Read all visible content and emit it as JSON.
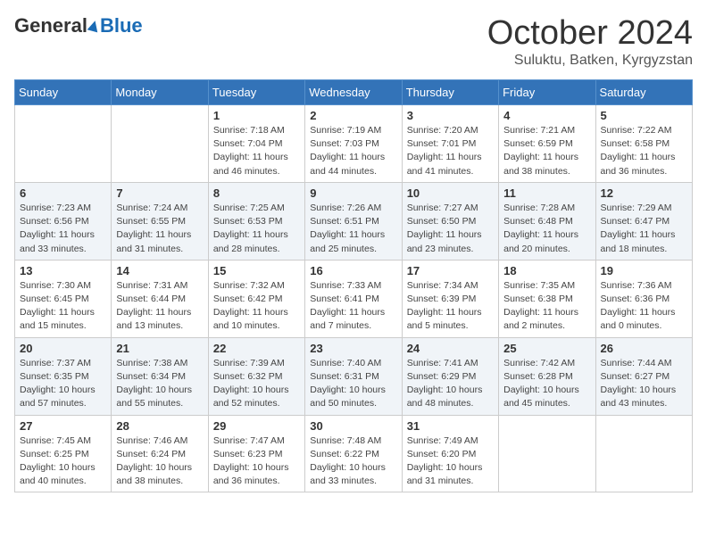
{
  "header": {
    "logo_general": "General",
    "logo_blue": "Blue",
    "month_title": "October 2024",
    "location": "Suluktu, Batken, Kyrgyzstan"
  },
  "days_of_week": [
    "Sunday",
    "Monday",
    "Tuesday",
    "Wednesday",
    "Thursday",
    "Friday",
    "Saturday"
  ],
  "weeks": [
    [
      {
        "day": "",
        "sunrise": "",
        "sunset": "",
        "daylight": ""
      },
      {
        "day": "",
        "sunrise": "",
        "sunset": "",
        "daylight": ""
      },
      {
        "day": "1",
        "sunrise": "Sunrise: 7:18 AM",
        "sunset": "Sunset: 7:04 PM",
        "daylight": "Daylight: 11 hours and 46 minutes."
      },
      {
        "day": "2",
        "sunrise": "Sunrise: 7:19 AM",
        "sunset": "Sunset: 7:03 PM",
        "daylight": "Daylight: 11 hours and 44 minutes."
      },
      {
        "day": "3",
        "sunrise": "Sunrise: 7:20 AM",
        "sunset": "Sunset: 7:01 PM",
        "daylight": "Daylight: 11 hours and 41 minutes."
      },
      {
        "day": "4",
        "sunrise": "Sunrise: 7:21 AM",
        "sunset": "Sunset: 6:59 PM",
        "daylight": "Daylight: 11 hours and 38 minutes."
      },
      {
        "day": "5",
        "sunrise": "Sunrise: 7:22 AM",
        "sunset": "Sunset: 6:58 PM",
        "daylight": "Daylight: 11 hours and 36 minutes."
      }
    ],
    [
      {
        "day": "6",
        "sunrise": "Sunrise: 7:23 AM",
        "sunset": "Sunset: 6:56 PM",
        "daylight": "Daylight: 11 hours and 33 minutes."
      },
      {
        "day": "7",
        "sunrise": "Sunrise: 7:24 AM",
        "sunset": "Sunset: 6:55 PM",
        "daylight": "Daylight: 11 hours and 31 minutes."
      },
      {
        "day": "8",
        "sunrise": "Sunrise: 7:25 AM",
        "sunset": "Sunset: 6:53 PM",
        "daylight": "Daylight: 11 hours and 28 minutes."
      },
      {
        "day": "9",
        "sunrise": "Sunrise: 7:26 AM",
        "sunset": "Sunset: 6:51 PM",
        "daylight": "Daylight: 11 hours and 25 minutes."
      },
      {
        "day": "10",
        "sunrise": "Sunrise: 7:27 AM",
        "sunset": "Sunset: 6:50 PM",
        "daylight": "Daylight: 11 hours and 23 minutes."
      },
      {
        "day": "11",
        "sunrise": "Sunrise: 7:28 AM",
        "sunset": "Sunset: 6:48 PM",
        "daylight": "Daylight: 11 hours and 20 minutes."
      },
      {
        "day": "12",
        "sunrise": "Sunrise: 7:29 AM",
        "sunset": "Sunset: 6:47 PM",
        "daylight": "Daylight: 11 hours and 18 minutes."
      }
    ],
    [
      {
        "day": "13",
        "sunrise": "Sunrise: 7:30 AM",
        "sunset": "Sunset: 6:45 PM",
        "daylight": "Daylight: 11 hours and 15 minutes."
      },
      {
        "day": "14",
        "sunrise": "Sunrise: 7:31 AM",
        "sunset": "Sunset: 6:44 PM",
        "daylight": "Daylight: 11 hours and 13 minutes."
      },
      {
        "day": "15",
        "sunrise": "Sunrise: 7:32 AM",
        "sunset": "Sunset: 6:42 PM",
        "daylight": "Daylight: 11 hours and 10 minutes."
      },
      {
        "day": "16",
        "sunrise": "Sunrise: 7:33 AM",
        "sunset": "Sunset: 6:41 PM",
        "daylight": "Daylight: 11 hours and 7 minutes."
      },
      {
        "day": "17",
        "sunrise": "Sunrise: 7:34 AM",
        "sunset": "Sunset: 6:39 PM",
        "daylight": "Daylight: 11 hours and 5 minutes."
      },
      {
        "day": "18",
        "sunrise": "Sunrise: 7:35 AM",
        "sunset": "Sunset: 6:38 PM",
        "daylight": "Daylight: 11 hours and 2 minutes."
      },
      {
        "day": "19",
        "sunrise": "Sunrise: 7:36 AM",
        "sunset": "Sunset: 6:36 PM",
        "daylight": "Daylight: 11 hours and 0 minutes."
      }
    ],
    [
      {
        "day": "20",
        "sunrise": "Sunrise: 7:37 AM",
        "sunset": "Sunset: 6:35 PM",
        "daylight": "Daylight: 10 hours and 57 minutes."
      },
      {
        "day": "21",
        "sunrise": "Sunrise: 7:38 AM",
        "sunset": "Sunset: 6:34 PM",
        "daylight": "Daylight: 10 hours and 55 minutes."
      },
      {
        "day": "22",
        "sunrise": "Sunrise: 7:39 AM",
        "sunset": "Sunset: 6:32 PM",
        "daylight": "Daylight: 10 hours and 52 minutes."
      },
      {
        "day": "23",
        "sunrise": "Sunrise: 7:40 AM",
        "sunset": "Sunset: 6:31 PM",
        "daylight": "Daylight: 10 hours and 50 minutes."
      },
      {
        "day": "24",
        "sunrise": "Sunrise: 7:41 AM",
        "sunset": "Sunset: 6:29 PM",
        "daylight": "Daylight: 10 hours and 48 minutes."
      },
      {
        "day": "25",
        "sunrise": "Sunrise: 7:42 AM",
        "sunset": "Sunset: 6:28 PM",
        "daylight": "Daylight: 10 hours and 45 minutes."
      },
      {
        "day": "26",
        "sunrise": "Sunrise: 7:44 AM",
        "sunset": "Sunset: 6:27 PM",
        "daylight": "Daylight: 10 hours and 43 minutes."
      }
    ],
    [
      {
        "day": "27",
        "sunrise": "Sunrise: 7:45 AM",
        "sunset": "Sunset: 6:25 PM",
        "daylight": "Daylight: 10 hours and 40 minutes."
      },
      {
        "day": "28",
        "sunrise": "Sunrise: 7:46 AM",
        "sunset": "Sunset: 6:24 PM",
        "daylight": "Daylight: 10 hours and 38 minutes."
      },
      {
        "day": "29",
        "sunrise": "Sunrise: 7:47 AM",
        "sunset": "Sunset: 6:23 PM",
        "daylight": "Daylight: 10 hours and 36 minutes."
      },
      {
        "day": "30",
        "sunrise": "Sunrise: 7:48 AM",
        "sunset": "Sunset: 6:22 PM",
        "daylight": "Daylight: 10 hours and 33 minutes."
      },
      {
        "day": "31",
        "sunrise": "Sunrise: 7:49 AM",
        "sunset": "Sunset: 6:20 PM",
        "daylight": "Daylight: 10 hours and 31 minutes."
      },
      {
        "day": "",
        "sunrise": "",
        "sunset": "",
        "daylight": ""
      },
      {
        "day": "",
        "sunrise": "",
        "sunset": "",
        "daylight": ""
      }
    ]
  ]
}
